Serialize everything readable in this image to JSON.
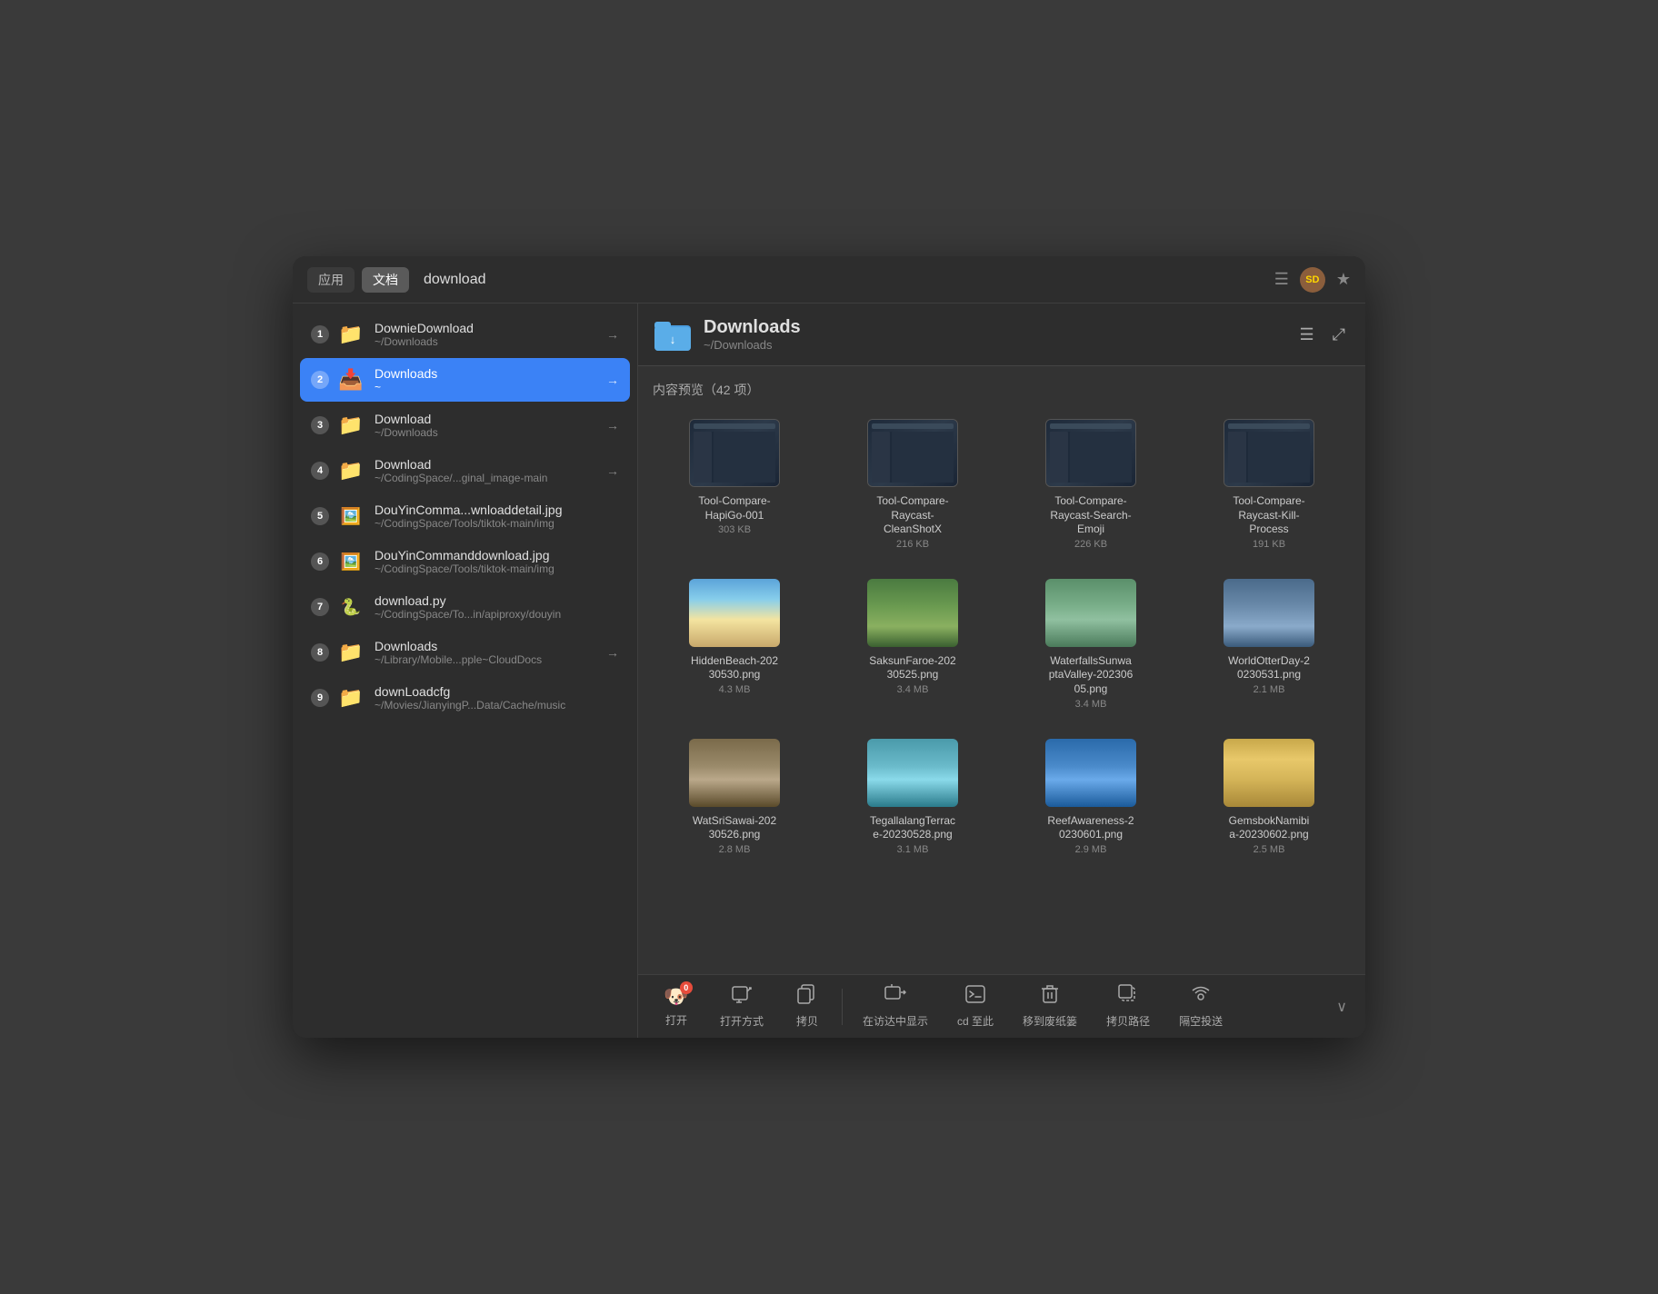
{
  "window": {
    "title": "download"
  },
  "titlebar": {
    "tabs": [
      {
        "label": "应用",
        "active": false
      },
      {
        "label": "文档",
        "active": true
      }
    ],
    "search": "download",
    "icons": {
      "filter": "☰",
      "badge": "SD",
      "pin": "★"
    }
  },
  "sidebar": {
    "items": [
      {
        "id": 1,
        "name": "DownieDownload",
        "path": "~/Downloads",
        "type": "folder",
        "has_arrow": true,
        "active": false
      },
      {
        "id": 2,
        "name": "Downloads",
        "path": "~",
        "type": "folder",
        "has_arrow": true,
        "active": true
      },
      {
        "id": 3,
        "name": "Download",
        "path": "~/Downloads",
        "type": "folder",
        "has_arrow": true,
        "active": false
      },
      {
        "id": 4,
        "name": "Download",
        "path": "~/CodingSpace/...ginal_image-main",
        "type": "folder",
        "has_arrow": true,
        "active": false
      },
      {
        "id": 5,
        "name": "DouYinComma...wnloaddetail.jpg",
        "path": "~/CodingSpace/Tools/tiktok-main/img",
        "type": "file-img",
        "has_arrow": false,
        "active": false
      },
      {
        "id": 6,
        "name": "DouYinCommanddownload.jpg",
        "path": "~/CodingSpace/Tools/tiktok-main/img",
        "type": "file-img",
        "has_arrow": false,
        "active": false
      },
      {
        "id": 7,
        "name": "download.py",
        "path": "~/CodingSpace/To...in/apiproxy/douyin",
        "type": "file-py",
        "has_arrow": false,
        "active": false
      },
      {
        "id": 8,
        "name": "Downloads",
        "path": "~/Library/Mobile...pple~CloudDocs",
        "type": "folder",
        "has_arrow": true,
        "active": false
      },
      {
        "id": 9,
        "name": "downLoadcfg",
        "path": "~/Movies/JianyingP...Data/Cache/music",
        "type": "folder",
        "has_arrow": false,
        "active": false
      }
    ]
  },
  "panel": {
    "title": "Downloads",
    "subtitle": "~/Downloads",
    "content_label": "内容预览（42 项）",
    "items": [
      {
        "name": "Tool-Compare-\nHapiGo-001",
        "size": "303 KB",
        "type": "screenshot"
      },
      {
        "name": "Tool-Compare-\nRaycast-\nCleanShotX",
        "size": "216 KB",
        "type": "screenshot"
      },
      {
        "name": "Tool-Compare-\nRaycast-Search-\nEmoji",
        "size": "226 KB",
        "type": "screenshot"
      },
      {
        "name": "Tool-Compare-\nRaycast-Kill-\nProcess",
        "size": "191 KB",
        "type": "screenshot"
      },
      {
        "name": "HiddenBeach-202\n30530.png",
        "size": "4.3 MB",
        "type": "photo-beach"
      },
      {
        "name": "SaksunFaroe-202\n30525.png",
        "size": "3.4 MB",
        "type": "photo-valley"
      },
      {
        "name": "WaterfallsSunwa\nptaValley-202306\n05.png",
        "size": "3.4 MB",
        "type": "photo-waterfall"
      },
      {
        "name": "WorldOtterDay-2\n0230531.png",
        "size": "2.1 MB",
        "type": "photo-otter"
      },
      {
        "name": "WatSriSawai-202\n30526.png",
        "size": "2.8 MB",
        "type": "photo-temple"
      },
      {
        "name": "TegallalangTerrac\ne-20230528.png",
        "size": "3.1 MB",
        "type": "photo-aerial"
      },
      {
        "name": "ReefAwareness-2\n0230601.png",
        "size": "2.9 MB",
        "type": "photo-reef"
      },
      {
        "name": "GemsbokNamibi\na-20230602.png",
        "size": "2.5 MB",
        "type": "photo-gemsbok"
      }
    ]
  },
  "toolbar": {
    "buttons": [
      {
        "label": "打开",
        "icon": "finder",
        "has_badge": true,
        "badge_count": "0"
      },
      {
        "label": "打开方式",
        "icon": "open-with",
        "has_badge": false
      },
      {
        "label": "拷贝",
        "icon": "copy",
        "has_badge": false
      },
      {
        "label": "在访达中显示",
        "icon": "show-finder",
        "has_badge": false
      },
      {
        "label": "cd 至此",
        "icon": "terminal",
        "has_badge": false
      },
      {
        "label": "移到废纸篓",
        "icon": "trash",
        "has_badge": false
      },
      {
        "label": "拷贝路径",
        "icon": "copy-path",
        "has_badge": false
      },
      {
        "label": "隔空投送",
        "icon": "airdrop",
        "has_badge": false
      }
    ]
  }
}
